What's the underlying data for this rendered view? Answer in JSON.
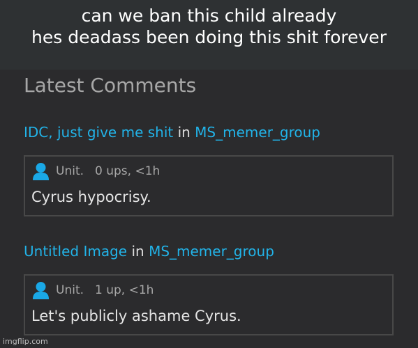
{
  "caption": {
    "line1": "can we ban this child already",
    "line2": "hes deadass been doing this shit forever"
  },
  "panel": {
    "title": "Latest Comments",
    "comments": [
      {
        "post_title": "IDC, just give me shit",
        "in_word": "in",
        "stream": "MS_memer_group",
        "username": "Unit.",
        "stats": "0 ups, <1h",
        "text": "Cyrus hypocrisy."
      },
      {
        "post_title": "Untitled Image",
        "in_word": "in",
        "stream": "MS_memer_group",
        "username": "Unit.",
        "stats": "1 up, <1h",
        "text": "Let's publicly ashame Cyrus."
      }
    ]
  },
  "watermark": "imgflip.com",
  "colors": {
    "link": "#22b3e8",
    "avatar": "#1aa8e6",
    "background": "#2b2b2d",
    "caption_bg": "#2e3133"
  },
  "icons": {
    "avatar": "user-icon"
  }
}
